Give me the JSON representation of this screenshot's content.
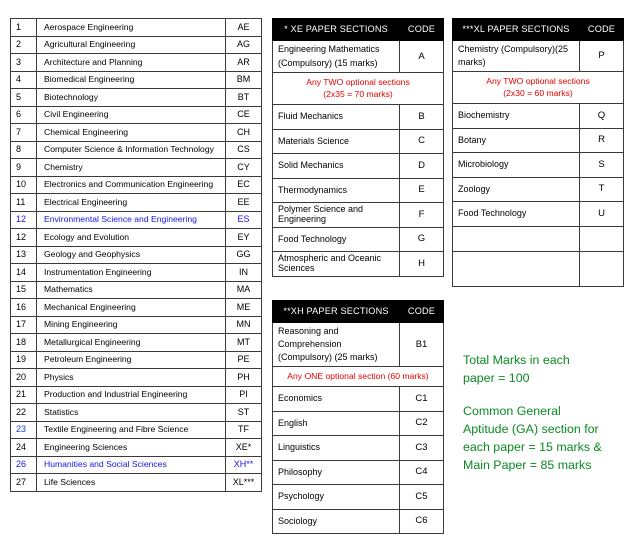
{
  "document": {
    "title": "GATE Papers and Codes"
  },
  "main_table": {
    "rows": [
      {
        "num": "1",
        "name": "Aerospace Engineering",
        "code": "AE",
        "highlight": false,
        "num_blue": false
      },
      {
        "num": "2",
        "name": "Agricultural Engineering",
        "code": "AG",
        "highlight": false,
        "num_blue": false
      },
      {
        "num": "3",
        "name": "Architecture and Planning",
        "code": "AR",
        "highlight": false,
        "num_blue": false
      },
      {
        "num": "4",
        "name": "Biomedical Engineering",
        "code": "BM",
        "highlight": false,
        "num_blue": false
      },
      {
        "num": "5",
        "name": "Biotechnology",
        "code": "BT",
        "highlight": false,
        "num_blue": false
      },
      {
        "num": "6",
        "name": "Civil Engineering",
        "code": "CE",
        "highlight": false,
        "num_blue": false
      },
      {
        "num": "7",
        "name": "Chemical Engineering",
        "code": "CH",
        "highlight": false,
        "num_blue": false
      },
      {
        "num": "8",
        "name": "Computer  Science & Information Technology",
        "code": "CS",
        "highlight": false,
        "num_blue": false
      },
      {
        "num": "9",
        "name": "Chemistry",
        "code": "CY",
        "highlight": false,
        "num_blue": false
      },
      {
        "num": "10",
        "name": "Electronics and Communication Engineering",
        "code": "EC",
        "highlight": false,
        "num_blue": false
      },
      {
        "num": "11",
        "name": "Electrical Engineering",
        "code": "EE",
        "highlight": false,
        "num_blue": false
      },
      {
        "num": "12",
        "name": "Environmental Science and Engineering",
        "code": "ES",
        "highlight": true,
        "num_blue": true
      },
      {
        "num": "12",
        "name": "Ecology and Evolution",
        "code": "EY",
        "highlight": false,
        "num_blue": false
      },
      {
        "num": "13",
        "name": "Geology and Geophysics",
        "code": "GG",
        "highlight": false,
        "num_blue": false
      },
      {
        "num": "14",
        "name": "Instrumentation Engineering",
        "code": "IN",
        "highlight": false,
        "num_blue": false
      },
      {
        "num": "15",
        "name": "Mathematics",
        "code": "MA",
        "highlight": false,
        "num_blue": false
      },
      {
        "num": "16",
        "name": "Mechanical Engineering",
        "code": "ME",
        "highlight": false,
        "num_blue": false
      },
      {
        "num": "17",
        "name": "Mining Engineering",
        "code": "MN",
        "highlight": false,
        "num_blue": false
      },
      {
        "num": "18",
        "name": "Metallurgical Engineering",
        "code": "MT",
        "highlight": false,
        "num_blue": false
      },
      {
        "num": "19",
        "name": "Petroleum Engineering",
        "code": "PE",
        "highlight": false,
        "num_blue": false
      },
      {
        "num": "20",
        "name": "Physics",
        "code": "PH",
        "highlight": false,
        "num_blue": false
      },
      {
        "num": "21",
        "name": "Production and Industrial Engineering",
        "code": "PI",
        "highlight": false,
        "num_blue": false
      },
      {
        "num": "22",
        "name": "Statistics",
        "code": "ST",
        "highlight": false,
        "num_blue": false
      },
      {
        "num": "23",
        "name": "Textile Engineering and Fibre Science",
        "code": "TF",
        "highlight": false,
        "num_blue": true
      },
      {
        "num": "24",
        "name": "Engineering Sciences",
        "code": "XE*",
        "highlight": false,
        "num_blue": false
      },
      {
        "num": "26",
        "name": "Humanities and Social Sciences",
        "code": "XH**",
        "highlight": true,
        "num_blue": true
      },
      {
        "num": "27",
        "name": "Life Sciences",
        "code": "XL***",
        "highlight": false,
        "num_blue": false
      }
    ]
  },
  "xe_table": {
    "header_title": "* XE PAPER SECTIONS",
    "header_code": "CODE",
    "compulsory": {
      "name": "Engineering Mathematics (Compulsory) (15 marks)",
      "code": "A"
    },
    "note_line1": "Any TWO optional sections",
    "note_line2": "(2x35 = 70 marks)",
    "sections": [
      {
        "name": "Fluid Mechanics",
        "code": "B"
      },
      {
        "name": "Materials Science",
        "code": "C"
      },
      {
        "name": "Solid Mechanics",
        "code": "D"
      },
      {
        "name": "Thermodynamics",
        "code": "E"
      },
      {
        "name": "Polymer Science and Engineering",
        "code": "F"
      },
      {
        "name": "Food Technology",
        "code": "G"
      },
      {
        "name": "Atmospheric and Oceanic Sciences",
        "code": "H"
      }
    ]
  },
  "xh_table": {
    "header_title": "**XH PAPER SECTIONS",
    "header_code": "CODE",
    "compulsory": {
      "name": "Reasoning and Comprehension (Compulsory) (25 marks)",
      "code": "B1"
    },
    "note_line1": "Any ONE optional section  (60 marks)",
    "sections": [
      {
        "name": "Economics",
        "code": "C1"
      },
      {
        "name": "English",
        "code": "C2"
      },
      {
        "name": "Linguistics",
        "code": "C3"
      },
      {
        "name": "Philosophy",
        "code": "C4"
      },
      {
        "name": "Psychology",
        "code": "C5"
      },
      {
        "name": "Sociology",
        "code": "C6"
      }
    ]
  },
  "xl_table": {
    "header_title": "***XL PAPER SECTIONS",
    "header_code": "CODE",
    "compulsory": {
      "name": "Chemistry (Compulsory)(25 marks)",
      "code": "P"
    },
    "note_line1": "Any TWO optional sections",
    "note_line2": "(2x30 = 60 marks)",
    "sections": [
      {
        "name": "Biochemistry",
        "code": "Q"
      },
      {
        "name": "Botany",
        "code": "R"
      },
      {
        "name": "Microbiology",
        "code": "S"
      },
      {
        "name": "Zoology",
        "code": "T"
      },
      {
        "name": "Food Technology",
        "code": "U"
      },
      {
        "name": "",
        "code": ""
      },
      {
        "name": "",
        "code": ""
      }
    ]
  },
  "notes": {
    "block1_line1": "Total Marks in each",
    "block1_line2": "paper  = 100",
    "block2_line1": "Common General",
    "block2_line2": "Aptitude (GA) section for",
    "block2_line3": "each paper = 15 marks &",
    "block2_line4": "Main Paper = 85 marks"
  },
  "colors": {
    "highlight_blue": "#1414e6",
    "note_red": "#e60000",
    "note_green": "#0a8a22",
    "header_bg": "#000000",
    "border": "#3b3b3b"
  }
}
